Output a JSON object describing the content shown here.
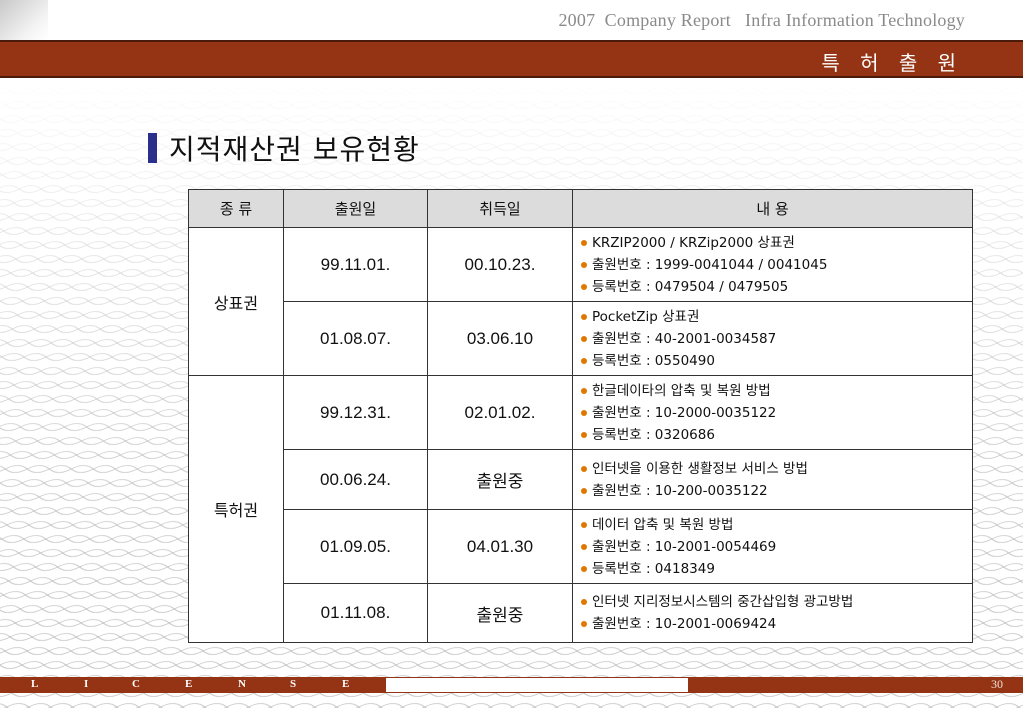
{
  "header": {
    "title": "2007  Company Report   Infra Information Technology",
    "section": "특 허 출 원"
  },
  "page": {
    "heading": "지적재산권 보유현황"
  },
  "table": {
    "columns": [
      "종 류",
      "출원일",
      "취득일",
      "내 용"
    ],
    "groups": [
      {
        "category": "상표권",
        "rows": [
          {
            "filed": "99.11.01.",
            "acquired": "00.10.23.",
            "lines": [
              "KRZIP2000 / KRZip2000 상표권",
              "출원번호 : 1999-0041044 / 0041045",
              "등록번호 : 0479504 / 0479505"
            ]
          },
          {
            "filed": "01.08.07.",
            "acquired": "03.06.10",
            "lines": [
              "PocketZip 상표권",
              "출원번호 : 40-2001-0034587",
              "등록번호 : 0550490"
            ]
          }
        ]
      },
      {
        "category": "특허권",
        "rows": [
          {
            "filed": "99.12.31.",
            "acquired": "02.01.02.",
            "lines": [
              "한글데이타의 압축 및 복원 방법",
              "출원번호 : 10-2000-0035122",
              "등록번호 : 0320686"
            ]
          },
          {
            "filed": "00.06.24.",
            "acquired": "출원중",
            "lines": [
              "인터넷을 이용한 생활정보 서비스 방법",
              "출원번호 : 10-200-0035122"
            ]
          },
          {
            "filed": "01.09.05.",
            "acquired": "04.01.30",
            "lines": [
              "데이터 압축 및 복원 방법",
              "출원번호 : 10-2001-0054469",
              "등록번호 : 0418349"
            ]
          },
          {
            "filed": "01.11.08.",
            "acquired": "출원중",
            "lines": [
              "인터넷 지리정보시스템의 중간삽입형 광고방법",
              "출원번호 : 10-2001-0069424"
            ]
          }
        ]
      }
    ]
  },
  "footer": {
    "letters": [
      "L",
      "I",
      "C",
      "E",
      "N",
      "S",
      "E"
    ],
    "page_number": "30"
  },
  "colors": {
    "band": "#953414",
    "marker": "#2a2f8c",
    "bullet": "#e07800",
    "header_row": "#dcdcdc"
  }
}
